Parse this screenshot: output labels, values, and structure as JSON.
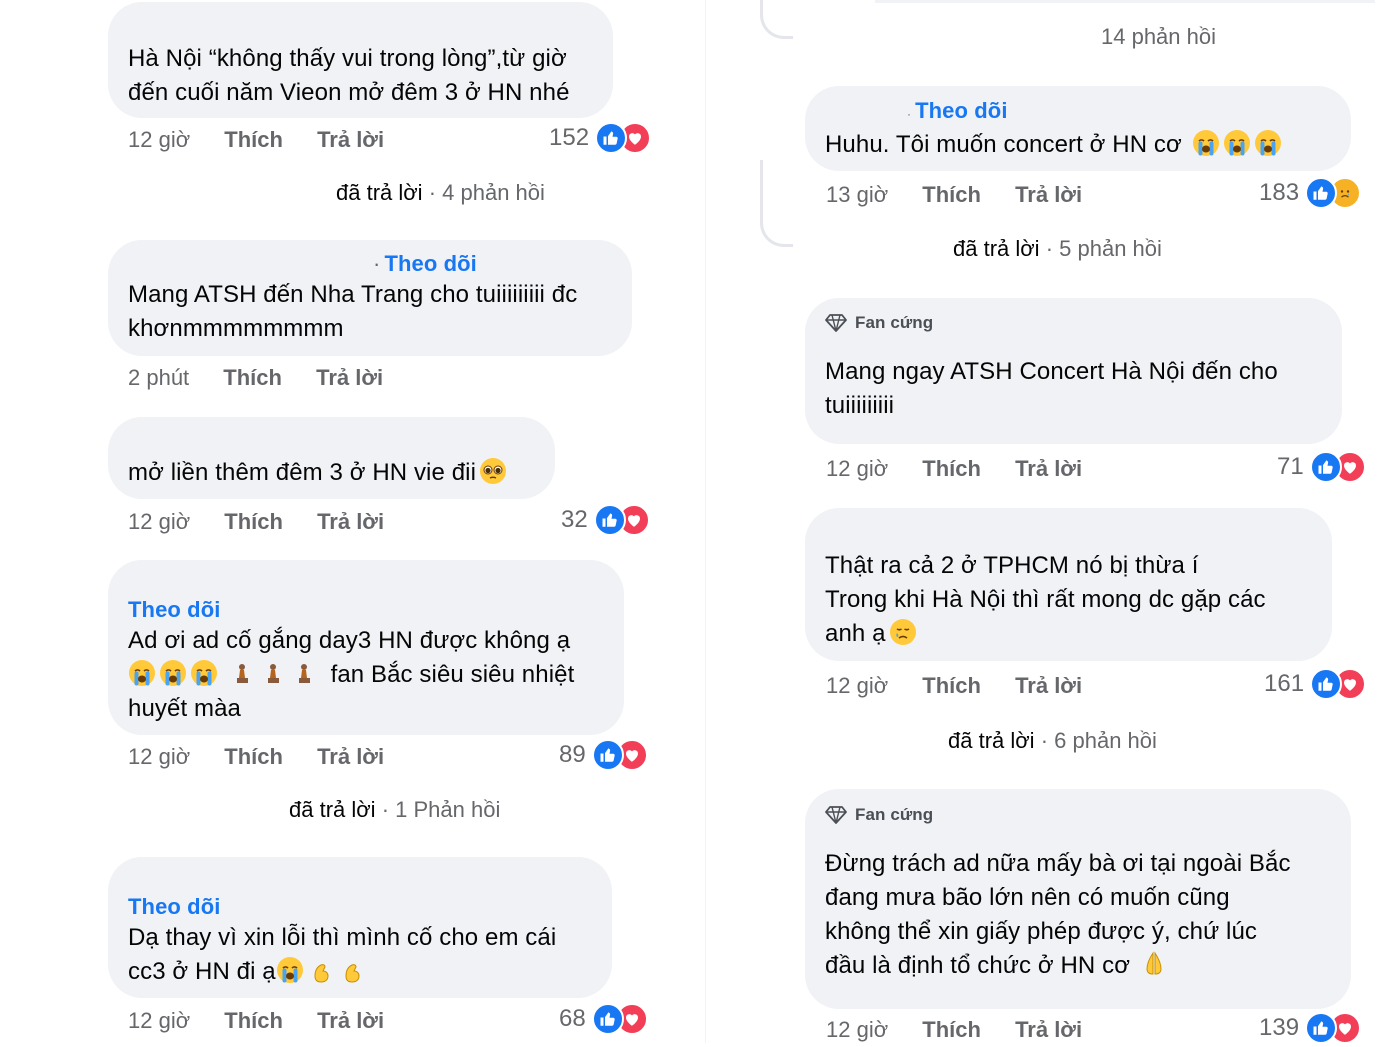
{
  "left": {
    "comments": [
      {
        "follow": "",
        "lines": [
          "Hà Nội “không thấy vui trong lòng”,từ giờ",
          "đến cuối năm Vieon mở đêm 3 ở HN nhé"
        ],
        "time": "12 giờ",
        "like": "Thích",
        "reply": "Trả lời",
        "count": "152",
        "reactions": [
          "like-icon",
          "love-icon"
        ]
      },
      {
        "follow": "Theo dõi",
        "lines": [
          "Mang ATSH đến Nha Trang cho tuiiiiiiiii đc",
          "khơnmmmmmmmm"
        ],
        "time": "2 phút",
        "like": "Thích",
        "reply": "Trả lời",
        "count": "",
        "reactions": []
      },
      {
        "follow": "",
        "lines": [
          "mở liền thêm đêm 3 ở HN vie đii"
        ],
        "time": "12 giờ",
        "like": "Thích",
        "reply": "Trả lời",
        "count": "32",
        "reactions": [
          "like-icon",
          "love-icon"
        ]
      },
      {
        "follow": "Theo dõi",
        "lines": [
          "Ad ơi ad cố gắng day3 HN được không ạ",
          "fan Bắc siêu siêu nhiệt",
          "huyết màa"
        ],
        "time": "12 giờ",
        "like": "Thích",
        "reply": "Trả lời",
        "count": "89",
        "reactions": [
          "like-icon",
          "love-icon"
        ]
      },
      {
        "follow": "Theo dõi",
        "lines": [
          "Dạ thay vì xin lỗi thì mình cố cho em cái",
          "cc3 ở HN đi ạ"
        ],
        "time": "12 giờ",
        "like": "Thích",
        "reply": "Trả lời",
        "count": "68",
        "reactions": [
          "like-icon",
          "love-icon"
        ]
      }
    ],
    "replies": [
      {
        "who": "đã trả lời",
        "sep": " · ",
        "count": "4 phản hồi"
      },
      {
        "who": "đã trả lời",
        "sep": " · ",
        "count": "1 Phản hồi"
      }
    ]
  },
  "right": {
    "top_replies": "14 phản hồi",
    "comments": [
      {
        "badge": "Theo dõi",
        "lines": [
          "Huhu. Tôi muốn concert ở HN cơ"
        ],
        "time": "13 giờ",
        "like": "Thích",
        "reply": "Trả lời",
        "count": "183",
        "reactions": [
          "like-icon",
          "sad-icon"
        ]
      },
      {
        "badge": "Fan cứng",
        "lines": [
          "Mang ngay ATSH Concert Hà Nội đến cho",
          "tuiiiiiiiii"
        ],
        "time": "12 giờ",
        "like": "Thích",
        "reply": "Trả lời",
        "count": "71",
        "reactions": [
          "like-icon",
          "love-icon"
        ]
      },
      {
        "badge": "",
        "lines": [
          "Thật ra cả 2 ở TPHCM nó bị thừa í",
          "Trong khi Hà Nội thì rất mong dc gặp các",
          "anh ạ"
        ],
        "time": "12 giờ",
        "like": "Thích",
        "reply": "Trả lời",
        "count": "161",
        "reactions": [
          "like-icon",
          "love-icon"
        ]
      },
      {
        "badge": "Fan cứng",
        "lines": [
          "Đừng trách ad nữa mấy bà ơi tại ngoài Bắc",
          "đang mưa bão lớn nên có muốn cũng",
          "không thể xin giấy phép được ý, chứ lúc",
          "đầu là định tổ chức ở HN cơ"
        ],
        "time": "12 giờ",
        "like": "Thích",
        "reply": "Trả lời",
        "count": "139",
        "reactions": [
          "like-icon",
          "love-icon"
        ]
      }
    ],
    "replies": [
      {
        "who": "đã trả lời",
        "sep": " · ",
        "count": "5 phản hồi"
      },
      {
        "who": "đã trả lời",
        "sep": " · ",
        "count": "6 phản hồi"
      }
    ]
  },
  "colors": {
    "bubble": "#f0f2f5",
    "link": "#1877f2",
    "meta": "#65676b",
    "like": "#1877f2",
    "love": "#f33e58",
    "sad": "#f7b125"
  }
}
